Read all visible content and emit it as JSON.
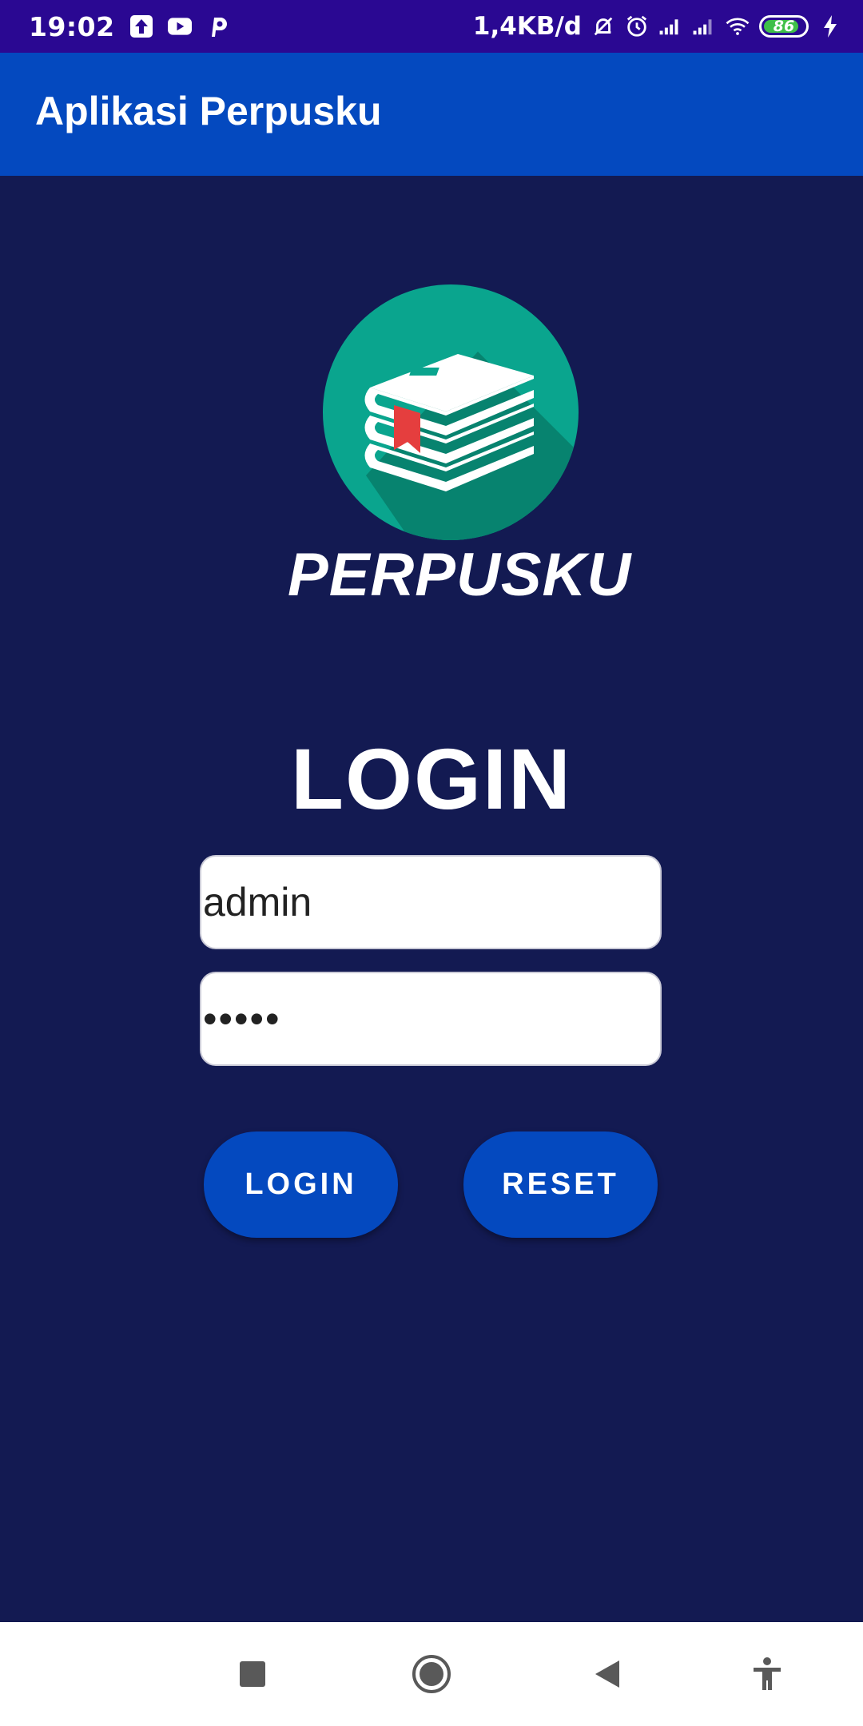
{
  "status_bar": {
    "time": "19:02",
    "left_icons": [
      "upload-icon",
      "youtube-icon",
      "p-app-icon"
    ],
    "net_speed": "1,4KB/d",
    "right_icons": [
      "notification-off-icon",
      "alarm-icon",
      "signal-icon",
      "signal-icon",
      "wifi-icon",
      "battery-icon",
      "charging-icon"
    ],
    "battery_level": "86",
    "background": "#2a0892"
  },
  "app_bar": {
    "title": "Aplikasi Perpusku",
    "background": "#0449bf"
  },
  "logo": {
    "text": "PERPUSKU",
    "circle_color": "#0aa58e",
    "bookmark_color": "#e53e3e"
  },
  "login": {
    "heading": "LOGIN",
    "username_value": "admin",
    "password_value": "•••••",
    "login_button": "LOGIN",
    "reset_button": "RESET"
  },
  "nav_bar": {
    "icons": [
      "recents-square-icon",
      "home-circle-icon",
      "back-triangle-icon",
      "accessibility-icon"
    ]
  },
  "colors": {
    "page_background": "#131a52",
    "accent": "#0449bf"
  }
}
